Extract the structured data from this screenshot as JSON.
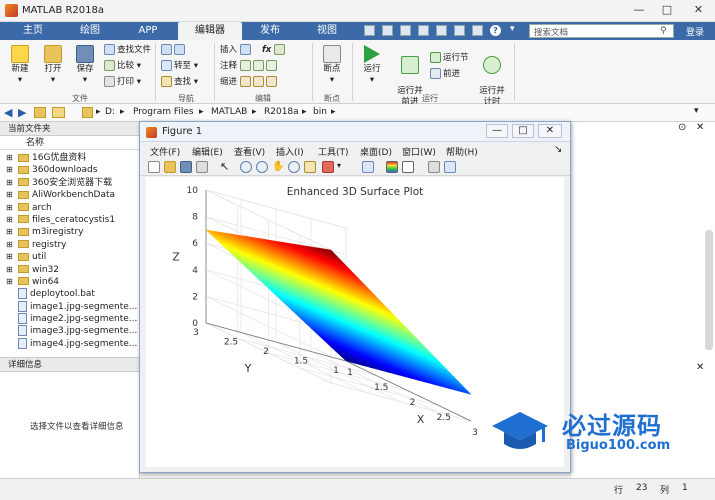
{
  "app": {
    "title": "MATLAB R2018a"
  },
  "search": {
    "placeholder": "搜索文档",
    "login": "登录"
  },
  "tabs": [
    "主页",
    "绘图",
    "APP",
    "编辑器",
    "发布",
    "视图"
  ],
  "ribbon": {
    "file": {
      "new": "新建",
      "open": "打开",
      "save": "保存",
      "find_files": "查找文件",
      "compare": "比较",
      "print": "打印",
      "group": "文件"
    },
    "nav": {
      "goto": "转至",
      "find": "查找",
      "group": "导航"
    },
    "edit": {
      "insert": "插入",
      "comment": "注释",
      "indent": "缩进",
      "fx": "fx",
      "group": "编辑"
    },
    "breakpoints": {
      "label": "断点",
      "group": "断点"
    },
    "run": {
      "run": "运行",
      "run_advance": "运行并\n前进",
      "run_section": "运行节",
      "advance": "前进",
      "run_time": "运行并\n计时",
      "group": "运行"
    }
  },
  "path": [
    "D:",
    "Program Files",
    "MATLAB",
    "R2018a",
    "bin"
  ],
  "current_folder": {
    "title": "当前文件夹",
    "col_name": "名称",
    "items": [
      {
        "name": "16G优盘资料",
        "type": "folder"
      },
      {
        "name": "360downloads",
        "type": "folder"
      },
      {
        "name": "360安全浏览器下载",
        "type": "folder"
      },
      {
        "name": "AliWorkbenchData",
        "type": "folder"
      },
      {
        "name": "arch",
        "type": "folder"
      },
      {
        "name": "files_ceratocystis1",
        "type": "folder"
      },
      {
        "name": "m3iregistry",
        "type": "folder"
      },
      {
        "name": "registry",
        "type": "folder"
      },
      {
        "name": "util",
        "type": "folder"
      },
      {
        "name": "win32",
        "type": "folder"
      },
      {
        "name": "win64",
        "type": "folder"
      },
      {
        "name": "deploytool.bat",
        "type": "file"
      },
      {
        "name": "image1.jpg-segmente...",
        "type": "file"
      },
      {
        "name": "image2.jpg-segmente...",
        "type": "file"
      },
      {
        "name": "image3.jpg-segmente...",
        "type": "file"
      },
      {
        "name": "image4.jpg-segmente...",
        "type": "file"
      }
    ]
  },
  "details": {
    "title": "详细信息",
    "hint": "选择文件以查看详细信息"
  },
  "figure": {
    "title": "Figure 1",
    "menus": [
      "文件(F)",
      "编辑(E)",
      "查看(V)",
      "插入(I)",
      "工具(T)",
      "桌面(D)",
      "窗口(W)",
      "帮助(H)"
    ]
  },
  "chart_data": {
    "type": "surface",
    "title": "Enhanced 3D Surface Plot",
    "xlabel": "X",
    "ylabel": "Y",
    "zlabel": "Z",
    "xlim": [
      1,
      3
    ],
    "ylim": [
      1,
      3
    ],
    "zlim": [
      0,
      10
    ],
    "xticks": [
      "1",
      "1.5",
      "2",
      "2.5",
      "3"
    ],
    "yticks": [
      "1",
      "1.5",
      "2",
      "2.5",
      "3"
    ],
    "zticks": [
      "0",
      "2",
      "4",
      "6",
      "8",
      "10"
    ],
    "colormap": "jet",
    "corners": [
      {
        "x": 1,
        "y": 1,
        "z": 0
      },
      {
        "x": 3,
        "y": 1,
        "z": 2
      },
      {
        "x": 1,
        "y": 3,
        "z": 7
      },
      {
        "x": 3,
        "y": 3,
        "z": 10
      }
    ],
    "grid": true
  },
  "statusbar": {
    "row_label": "行",
    "row_value": "23",
    "col_label": "列",
    "col_value": "1"
  },
  "watermark": {
    "text": "必过源码",
    "url": "Biguo100.com"
  }
}
